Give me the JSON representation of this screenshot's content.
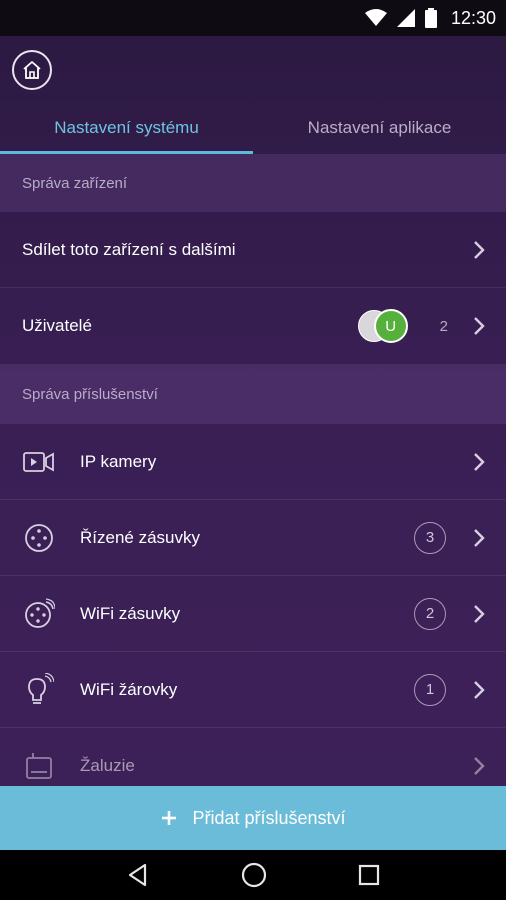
{
  "status": {
    "time": "12:30"
  },
  "tabs": [
    {
      "label": "Nastavení systému",
      "active": true
    },
    {
      "label": "Nastavení aplikace",
      "active": false
    }
  ],
  "sections": {
    "devices": "Správa zařízení",
    "accessories": "Správa příslušenství"
  },
  "device_rows": {
    "share": {
      "label": "Sdílet toto zařízení s dalšími"
    },
    "users": {
      "label": "Uživatelé",
      "avatar_letter": "U",
      "count": "2"
    }
  },
  "accessory_rows": [
    {
      "label": "IP kamery",
      "icon": "camera-icon"
    },
    {
      "label": "Řízené zásuvky",
      "icon": "socket-icon",
      "count": "3"
    },
    {
      "label": "WiFi zásuvky",
      "icon": "wifi-socket-icon",
      "count": "2"
    },
    {
      "label": "WiFi žárovky",
      "icon": "bulb-icon",
      "count": "1"
    },
    {
      "label": "Žaluzie",
      "icon": "blinds-icon"
    }
  ],
  "add_button": {
    "label": "Přidat příslušenství"
  },
  "colors": {
    "accent": "#6ec3e0",
    "add_bar": "#6bbcd9",
    "background": "#3a1f55"
  }
}
